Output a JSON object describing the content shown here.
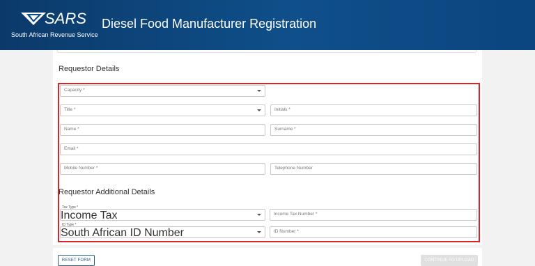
{
  "header": {
    "logo_text": "SARS",
    "logo_tagline": "South African Revenue Service",
    "page_title": "Diesel Food Manufacturer Registration"
  },
  "requestor_details": {
    "title": "Requestor Details",
    "capacity": {
      "placeholder": "Capacity *"
    },
    "title_field": {
      "placeholder": "Title *"
    },
    "initials": {
      "placeholder": "Initials *"
    },
    "name": {
      "placeholder": "Name *"
    },
    "surname": {
      "placeholder": "Surname *"
    },
    "email": {
      "placeholder": "Email *"
    },
    "mobile_number": {
      "placeholder": "Mobile Number *"
    },
    "telephone_number": {
      "placeholder": "Telephone Number"
    }
  },
  "additional_details": {
    "title": "Requestor Additional Details",
    "tax_type": {
      "label": "Tax Type *",
      "value": "Income Tax"
    },
    "income_tax_number": {
      "placeholder": "Income Tax Number *"
    },
    "id_type": {
      "label": "ID Type *",
      "value": "South African ID Number"
    },
    "id_number": {
      "placeholder": "ID Number *"
    }
  },
  "footer": {
    "reset_label": "RESET FORM",
    "continue_label": "CONTINUE TO UPLOAD"
  },
  "colors": {
    "header_blue": "#0f4f8a",
    "highlight_red": "#d9232a",
    "button_outline": "#2a5c8a",
    "disabled_button": "#e0e0e0"
  }
}
